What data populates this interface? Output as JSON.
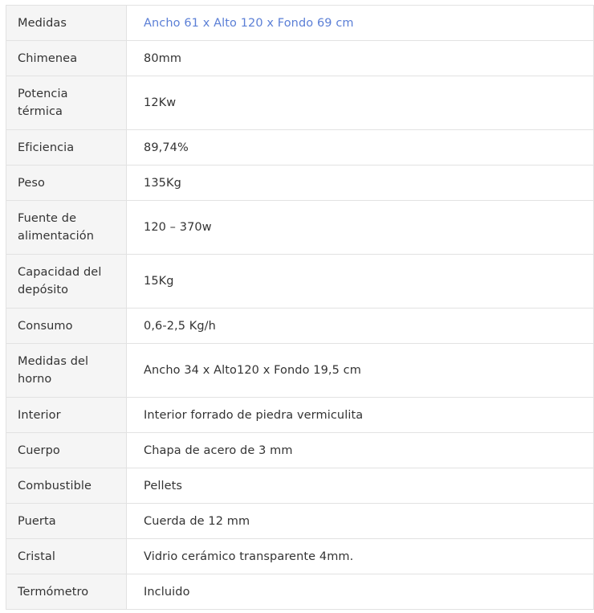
{
  "spec_table": {
    "rows": [
      {
        "label": "Medidas",
        "value": "Ancho 61 x Alto 120 x Fondo 69 cm"
      },
      {
        "label": "Chimenea",
        "value": "80mm"
      },
      {
        "label": "Potencia térmica",
        "value": "12Kw"
      },
      {
        "label": "Eficiencia",
        "value": "89,74%"
      },
      {
        "label": "Peso",
        "value": "135Kg"
      },
      {
        "label": "Fuente de alimentación",
        "value": "120 – 370w"
      },
      {
        "label": "Capacidad del depósito",
        "value": "15Kg"
      },
      {
        "label": "Consumo",
        "value": "0,6-2,5 Kg/h"
      },
      {
        "label": "Medidas del horno",
        "value": "Ancho 34 x Alto120 x Fondo 19,5 cm"
      },
      {
        "label": "Interior",
        "value": "Interior forrado de piedra vermiculita"
      },
      {
        "label": "Cuerpo",
        "value": "Chapa de acero de 3 mm"
      },
      {
        "label": "Combustible",
        "value": "Pellets"
      },
      {
        "label": "Puerta",
        "value": "Cuerda de 12 mm"
      },
      {
        "label": "Cristal",
        "value": "Vidrio cerámico transparente 4mm."
      },
      {
        "label": "Termómetro",
        "value": "Incluido"
      }
    ]
  },
  "colors": {
    "label_background": "#f5f5f5",
    "border": "#e2e2e2",
    "text": "#333333",
    "link": "#5b7fd6"
  }
}
